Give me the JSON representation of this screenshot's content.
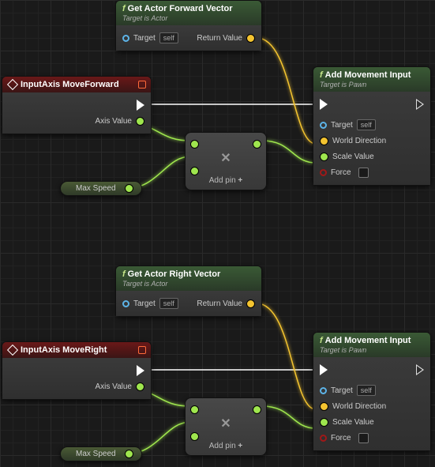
{
  "nodes": {
    "getForward": {
      "title": "Get Actor Forward Vector",
      "subtitle": "Target is Actor",
      "target": "Target",
      "self": "self",
      "ret": "Return Value"
    },
    "getRight": {
      "title": "Get Actor Right Vector",
      "subtitle": "Target is Actor",
      "target": "Target",
      "self": "self",
      "ret": "Return Value"
    },
    "inputFwd": {
      "title": "InputAxis MoveForward",
      "axis": "Axis Value"
    },
    "inputRight": {
      "title": "InputAxis MoveRight",
      "axis": "Axis Value"
    },
    "addMove1": {
      "title": "Add Movement Input",
      "subtitle": "Target is Pawn",
      "target": "Target",
      "self": "self",
      "dir": "World Direction",
      "scale": "Scale Value",
      "force": "Force"
    },
    "addMove2": {
      "title": "Add Movement Input",
      "subtitle": "Target is Pawn",
      "target": "Target",
      "self": "self",
      "dir": "World Direction",
      "scale": "Scale Value",
      "force": "Force"
    },
    "mult": {
      "addpin": "Add pin",
      "sym": "✕"
    },
    "maxSpeed": "Max Speed"
  }
}
